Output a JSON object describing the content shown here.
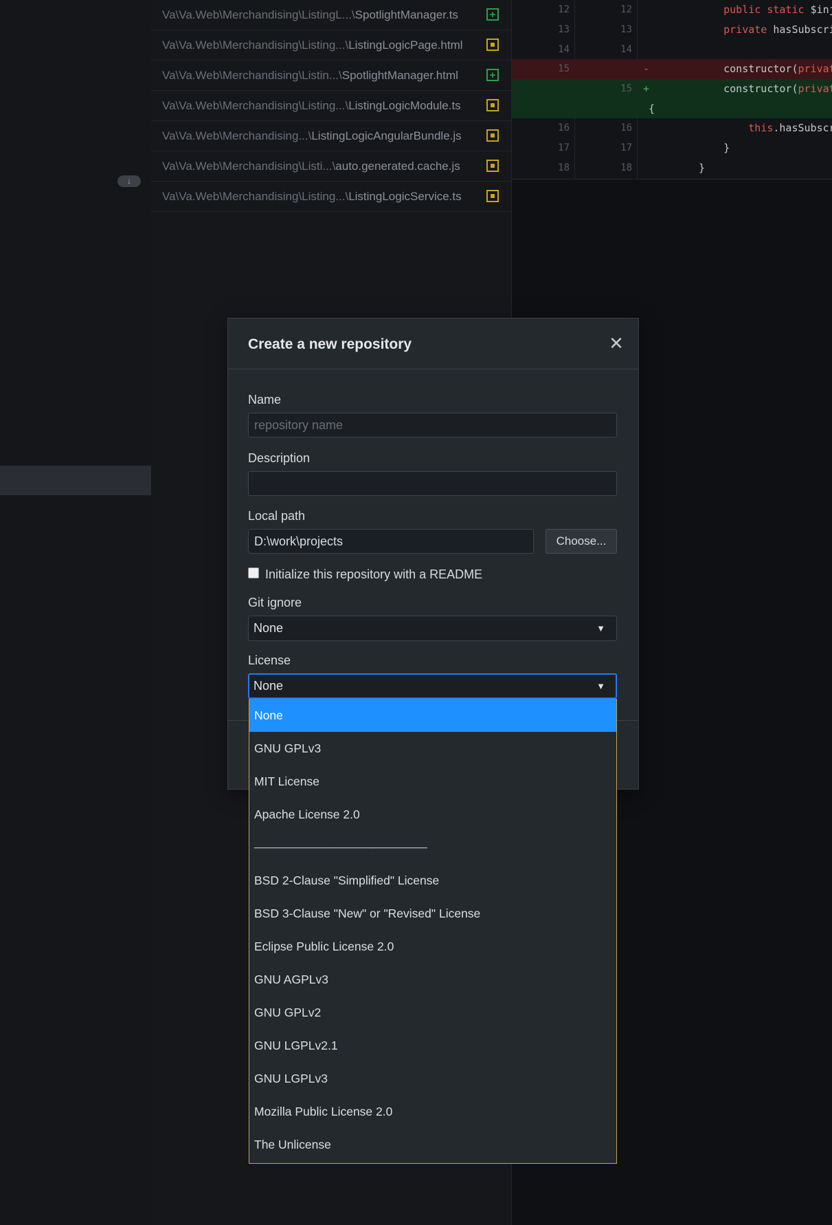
{
  "sidebar": {
    "badge_icon": "arrow-down-icon"
  },
  "files": [
    {
      "dir": "Va\\Va.Web\\Merchandising\\ListingL...\\",
      "name": "SpotlightManager.ts",
      "status": "added"
    },
    {
      "dir": "Va\\Va.Web\\Merchandising\\Listing...\\",
      "name": "ListingLogicPage.html",
      "status": "modified"
    },
    {
      "dir": "Va\\Va.Web\\Merchandising\\Listin...\\",
      "name": "SpotlightManager.html",
      "status": "added"
    },
    {
      "dir": "Va\\Va.Web\\Merchandising\\Listing...\\",
      "name": "ListingLogicModule.ts",
      "status": "modified"
    },
    {
      "dir": "Va\\Va.Web\\Merchandising...\\",
      "name": "ListingLogicAngularBundle.js",
      "status": "modified"
    },
    {
      "dir": "Va\\Va.Web\\Merchandising\\Listi...\\",
      "name": "auto.generated.cache.js",
      "status": "modified"
    },
    {
      "dir": "Va\\Va.Web\\Merchandising\\Listing...\\",
      "name": "ListingLogicService.ts",
      "status": "modified"
    }
  ],
  "diff": {
    "rows": [
      {
        "a": "12",
        "b": "12",
        "sign": "",
        "type": "ctx",
        "code": "    public static $inject"
      },
      {
        "a": "13",
        "b": "13",
        "sign": "",
        "type": "ctx",
        "code": "    private hasSubscribedT"
      },
      {
        "a": "14",
        "b": "14",
        "sign": "",
        "type": "ctx",
        "code": ""
      },
      {
        "a": "15",
        "b": "",
        "sign": "-",
        "type": "del",
        "code": "    constructor(private di"
      },
      {
        "a": "",
        "b": "15",
        "sign": "+",
        "type": "add",
        "code": "    constructor(private li"
      },
      {
        "a": "",
        "b": "",
        "sign": "",
        "type": "add",
        "code": "{"
      },
      {
        "a": "16",
        "b": "16",
        "sign": "",
        "type": "ctx",
        "code": "        this.hasSubscribed"
      },
      {
        "a": "17",
        "b": "17",
        "sign": "",
        "type": "ctx",
        "code": "    }"
      },
      {
        "a": "18",
        "b": "18",
        "sign": "",
        "type": "ctx",
        "code": "}"
      }
    ]
  },
  "modal": {
    "title": "Create a new repository",
    "close_icon": "close-icon",
    "name_label": "Name",
    "name_placeholder": "repository name",
    "name_value": "",
    "description_label": "Description",
    "description_value": "",
    "local_path_label": "Local path",
    "local_path_value": "D:\\work\\projects",
    "choose_label": "Choose...",
    "readme_label": "Initialize this repository with a README",
    "readme_checked": false,
    "gitignore_label": "Git ignore",
    "gitignore_value": "None",
    "license_label": "License",
    "license_value": "None"
  },
  "license_options": [
    "None",
    "GNU GPLv3",
    "MIT License",
    "Apache License 2.0",
    "──────────────────────",
    "BSD 2-Clause \"Simplified\" License",
    "BSD 3-Clause \"New\" or \"Revised\" License",
    "Eclipse Public License 2.0",
    "GNU AGPLv3",
    "GNU GPLv2",
    "GNU LGPLv2.1",
    "GNU LGPLv3",
    "Mozilla Public License 2.0",
    "The Unlicense"
  ],
  "colors": {
    "accent": "#1e90ff",
    "focus": "#2f81f7",
    "added": "#2ea043",
    "modified": "#c9a31f"
  }
}
